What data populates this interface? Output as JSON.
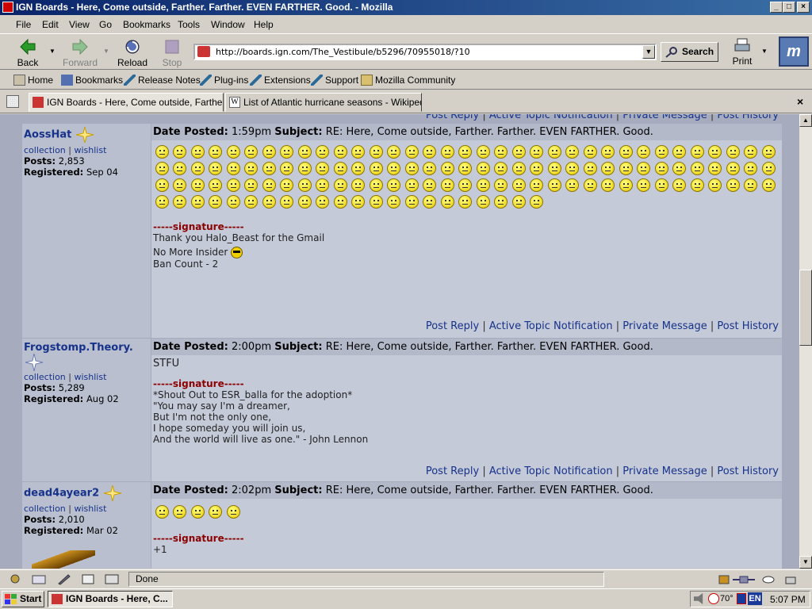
{
  "window": {
    "title": "IGN Boards - Here, Come outside, Farther. Farther. EVEN FARTHER. Good. - Mozilla",
    "min": "_",
    "max": "□",
    "close": "×"
  },
  "menu": [
    "File",
    "Edit",
    "View",
    "Go",
    "Bookmarks",
    "Tools",
    "Window",
    "Help"
  ],
  "nav": {
    "back": "Back",
    "forward": "Forward",
    "reload": "Reload",
    "stop": "Stop",
    "url": "http://boards.ign.com/The_Vestibule/b5296/70955018/?10",
    "search": "Search",
    "print": "Print",
    "logo": "m"
  },
  "personal": [
    "Home",
    "Bookmarks",
    "Release Notes",
    "Plug-ins",
    "Extensions",
    "Support",
    "Mozilla Community"
  ],
  "tabs": [
    {
      "label": "IGN Boards - Here, Come outside, Farther. F..."
    },
    {
      "label": "List of Atlantic hurricane seasons - Wikipedi..."
    }
  ],
  "tab_close": "×",
  "footer_links": {
    "reply": "Post Reply",
    "notify": "Active Topic Notification",
    "pm": "Private Message",
    "history": "Post History",
    "sep": "|"
  },
  "top_footer": {
    "reply": "Post Reply",
    "notify": "Active Topic Notification",
    "pm": "Private Message",
    "history": "Post History"
  },
  "labels": {
    "collection": "collection",
    "wishlist": "wishlist",
    "posts": "Posts:",
    "registered": "Registered:",
    "date_posted": "Date Posted:",
    "subject": "Subject:",
    "signature": "-----signature-----"
  },
  "posts": [
    {
      "user": "AossHat",
      "posts": "2,853",
      "registered": "Sep 04",
      "time": "1:59pm",
      "subject": "RE: Here, Come outside, Farther. Farther. EVEN FARTHER. Good.",
      "smiley_count": 127,
      "sig": [
        "Thank you Halo_Beast for the Gmail",
        "No More Insider",
        "Ban Count - 2"
      ]
    },
    {
      "user": "Frogstomp.Theory.",
      "posts": "5,289",
      "registered": "Aug 02",
      "time": "2:00pm",
      "subject": "RE: Here, Come outside, Farther. Farther. EVEN FARTHER. Good.",
      "body": "STFU",
      "sig": [
        "*Shout Out to ESR_balla for the adoption*",
        "\"You may say I'm a dreamer,",
        "But I'm not the only one,",
        "I hope someday you will join us,",
        "And the world will live as one.\" - John Lennon"
      ]
    },
    {
      "user": "dead4ayear2",
      "posts": "2,010",
      "registered": "Mar 02",
      "time": "2:02pm",
      "subject": "RE: Here, Come outside, Farther. Farther. EVEN FARTHER. Good.",
      "smiley_count": 5,
      "sig": [
        "+1"
      ]
    }
  ],
  "status": {
    "text": "Done"
  },
  "taskbar": {
    "start": "Start",
    "item": "IGN Boards - Here, C...",
    "temp": "70°",
    "lang": "EN",
    "clock": "5:07 PM"
  },
  "colors": {
    "title_blue": "#0a246a",
    "link_blue": "#16328a",
    "signature_red": "#8b0000",
    "content_bg": "#a6acbe"
  }
}
